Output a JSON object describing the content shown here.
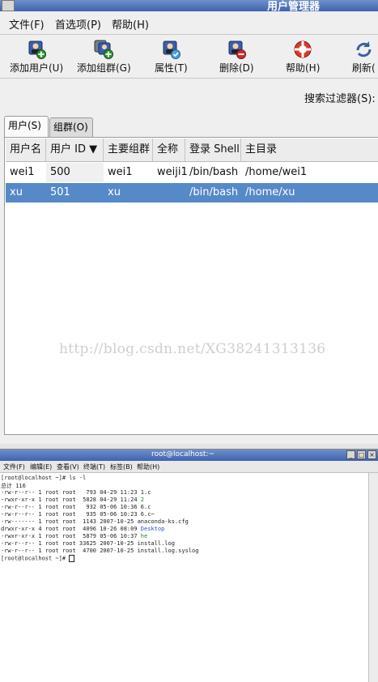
{
  "window": {
    "title": "用户管理器"
  },
  "menu": [
    "文件(F)",
    "首选项(P)",
    "帮助(H)"
  ],
  "toolbar": [
    {
      "label": "添加用户(U)",
      "icon": "add-user-icon"
    },
    {
      "label": "添加组群(G)",
      "icon": "add-group-icon"
    },
    {
      "label": "属性(T)",
      "icon": "properties-icon"
    },
    {
      "label": "删除(D)",
      "icon": "delete-icon"
    },
    {
      "label": "帮助(H)",
      "icon": "help-icon"
    },
    {
      "label": "刷新(",
      "icon": "refresh-icon"
    }
  ],
  "search": {
    "label": "搜索过滤器(S):"
  },
  "tabs": [
    {
      "label": "用户(S)"
    },
    {
      "label": "组群(O)"
    }
  ],
  "table": {
    "headers": [
      "用户名",
      "用户 ID ▼",
      "主要组群",
      "全称",
      "登录 Shell",
      "主目录"
    ],
    "rows": [
      [
        "wei1",
        "500",
        "wei1",
        "weiji1",
        "/bin/bash",
        "/home/wei1"
      ],
      [
        "xu",
        "501",
        "xu",
        "",
        "/bin/bash",
        "/home/xu"
      ]
    ],
    "selected_row": 1
  },
  "watermark": "http://blog.csdn.net/XG38241313136",
  "terminal": {
    "title": "root@localhost:~",
    "menu": [
      "文件(F)",
      "编辑(E)",
      "查看(V)",
      "终端(T)",
      "标签(B)",
      "帮助(H)"
    ],
    "lines": {
      "l0": "[root@localhost ~]# ls -l",
      "l1": "总计 116",
      "l2a": "-rw-r--r-- 1 root root   793 04-29 11:23 ",
      "l2b": "1.c",
      "l3a": "-rwxr-xr-x 1 root root  5828 04-29 11:24 ",
      "l3b": "2",
      "l4a": "-rw-r--r-- 1 root root   932 05-06 10:36 ",
      "l4b": "6.c",
      "l5a": "-rw-r--r-- 1 root root   935 05-06 10:23 ",
      "l5b": "6.c~",
      "l6a": "-rw------- 1 root root  1143 2007-10-25 ",
      "l6b": "anaconda-ks.cfg",
      "l7a": "drwxr-xr-x 4 root root  4096 10-26 08:09 ",
      "l7b": "Desktop",
      "l8a": "-rwxr-xr-x 1 root root  5879 05-06 10:37 ",
      "l8b": "he",
      "l9a": "-rw-r--r-- 1 root root 33625 2007-10-25 ",
      "l9b": "install.log",
      "l10a": "-rw-r--r-- 1 root root  4700 2007-10-25 ",
      "l10b": "install.log.syslog",
      "l11": "[root@localhost ~]# "
    }
  }
}
